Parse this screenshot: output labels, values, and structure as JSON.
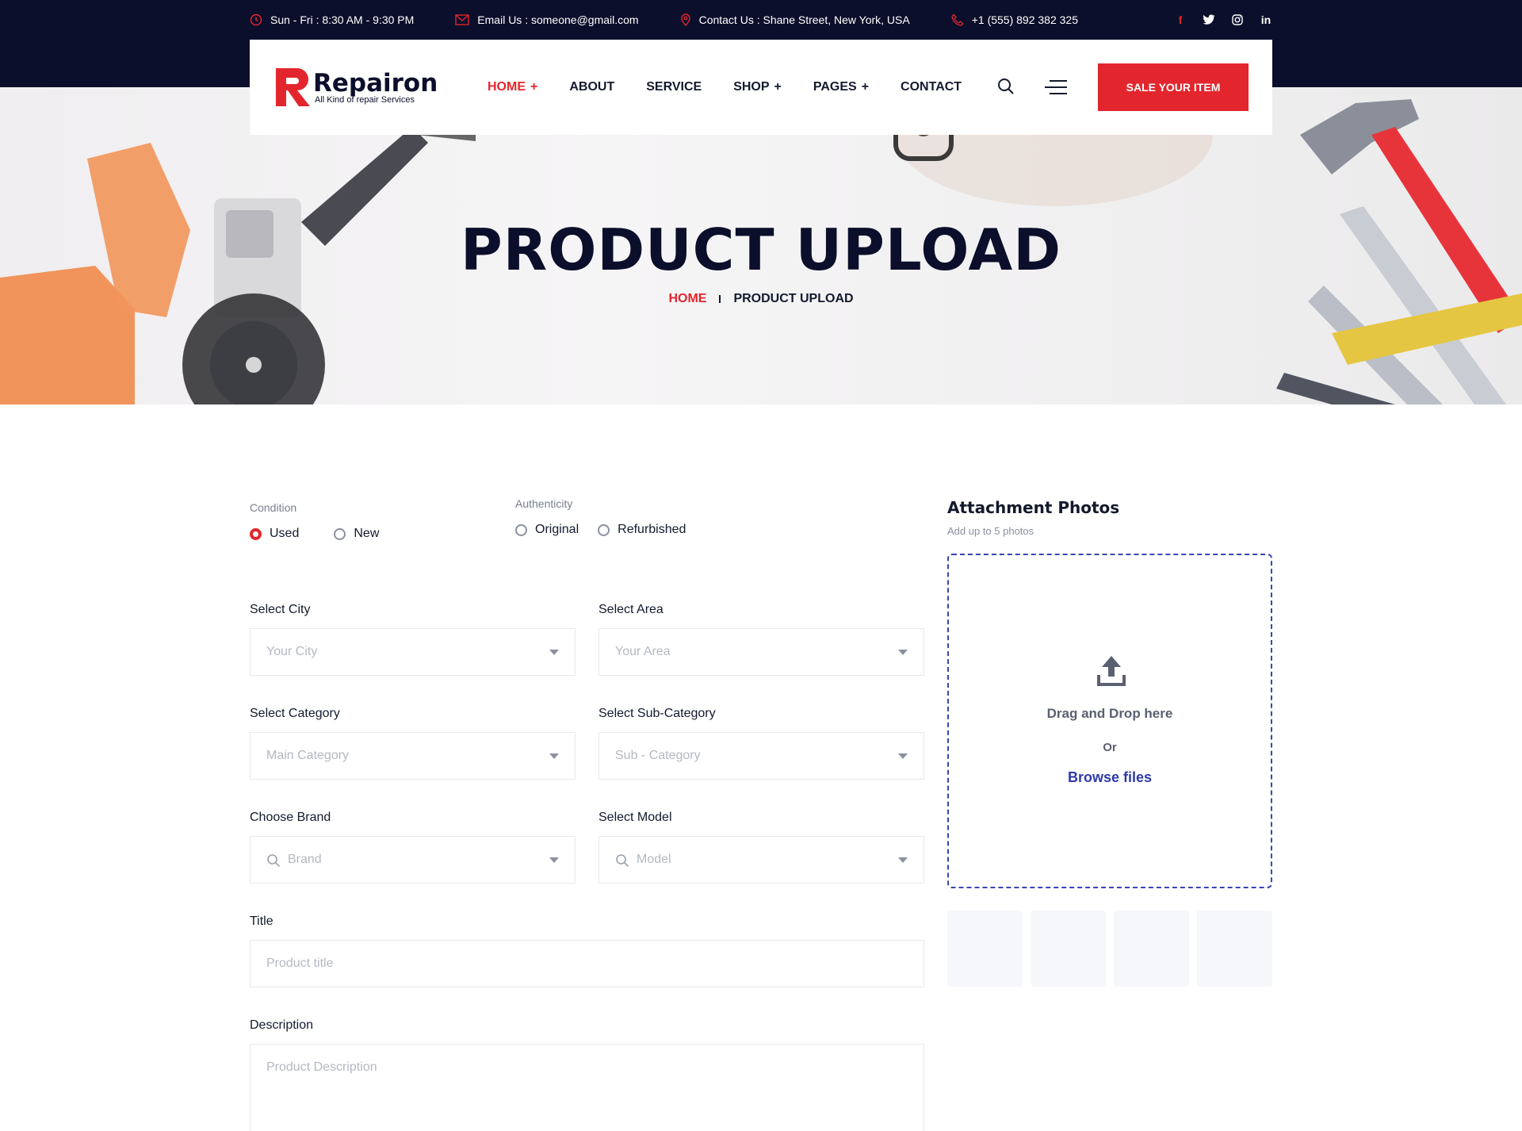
{
  "topbar": {
    "hours": "Sun - Fri : 8:30 AM - 9:30 PM",
    "email": "Email Us : someone@gmail.com",
    "address": "Contact Us : Shane Street, New York, USA",
    "phone": "+1 (555) 892 382 325",
    "social": [
      "f",
      "twitter",
      "instagram",
      "in"
    ]
  },
  "brand": {
    "name": "Repairon",
    "tagline": "All Kind of repair Services",
    "accent": "#e3262d",
    "navy": "#0c0f2b"
  },
  "nav": {
    "items": [
      {
        "label": "HOME",
        "plus": "+"
      },
      {
        "label": "ABOUT",
        "plus": ""
      },
      {
        "label": "SERVICE",
        "plus": ""
      },
      {
        "label": "SHOP",
        "plus": "+"
      },
      {
        "label": "PAGES",
        "plus": "+"
      },
      {
        "label": "CONTACT",
        "plus": ""
      }
    ],
    "cta": "SALE YOUR ITEM"
  },
  "hero": {
    "title": "PRODUCT UPLOAD",
    "crumb_home": "HOME",
    "crumb_current": "PRODUCT UPLOAD"
  },
  "form": {
    "condition": {
      "label": "Condition",
      "options": [
        "Used",
        "New"
      ],
      "selected": "Used"
    },
    "authenticity": {
      "label": "Authenticity",
      "options": [
        "Original",
        "Refurbished"
      ]
    },
    "city": {
      "label": "Select City",
      "placeholder": "Your City"
    },
    "area": {
      "label": "Select Area",
      "placeholder": "Your Area"
    },
    "category": {
      "label": "Select Category",
      "placeholder": "Main Category"
    },
    "subcategory": {
      "label": "Select Sub-Category",
      "placeholder": "Sub - Category"
    },
    "brand": {
      "label": "Choose Brand",
      "placeholder": "Brand"
    },
    "model": {
      "label": "Select Model",
      "placeholder": "Model"
    },
    "title": {
      "label": "Title",
      "placeholder": "Product title"
    },
    "description": {
      "label": "Description",
      "placeholder": "Product Description"
    }
  },
  "attachments": {
    "title": "Attachment Photos",
    "subtitle": "Add up to 5 photos",
    "drag_text": "Drag and Drop here",
    "or_text": "Or",
    "browse_text": "Browse files",
    "thumb_slots": 4
  }
}
